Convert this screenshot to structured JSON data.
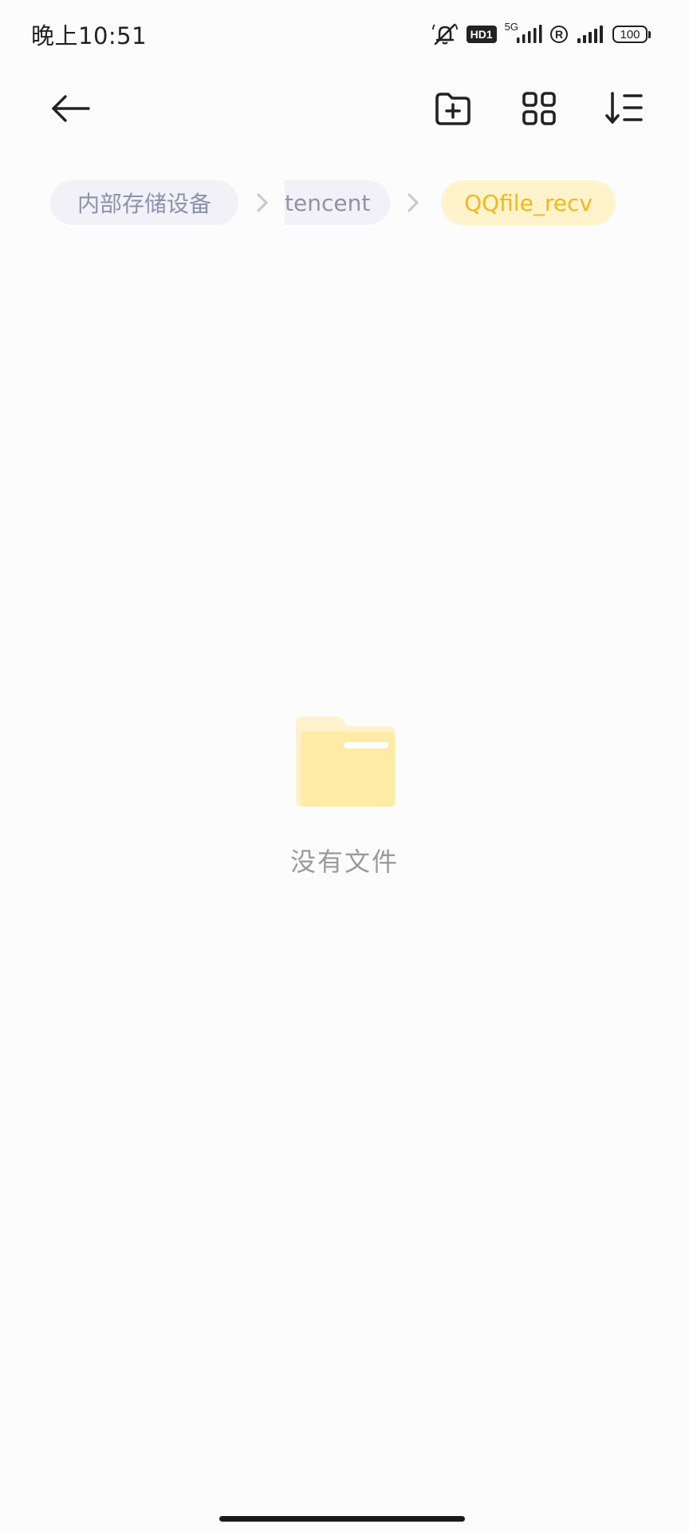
{
  "status_bar": {
    "time": "晚上10:51",
    "hd_badge": "HD1",
    "network": "5G",
    "roaming": "R",
    "battery": "100",
    "icons": [
      "mute-icon",
      "hd-badge",
      "signal-5g-icon",
      "roaming-icon",
      "signal-icon",
      "battery-icon"
    ]
  },
  "toolbar": {
    "icons": [
      "back-arrow-icon",
      "new-folder-icon",
      "grid-view-icon",
      "sort-icon"
    ]
  },
  "breadcrumb": {
    "items": [
      "内部存储设备",
      "tencent",
      "QQfile_recv"
    ],
    "separator_icon": "chevron-right-icon"
  },
  "empty_state": {
    "icon": "folder-icon",
    "text": "没有文件"
  },
  "colors": {
    "background": "#fdfcfd",
    "crumb_bg": "#f1f1f7",
    "crumb_text": "#8c92ae",
    "accent_bg": "#fff3cc",
    "accent_text": "#f4b81a",
    "folder": "#ffeaa6"
  }
}
